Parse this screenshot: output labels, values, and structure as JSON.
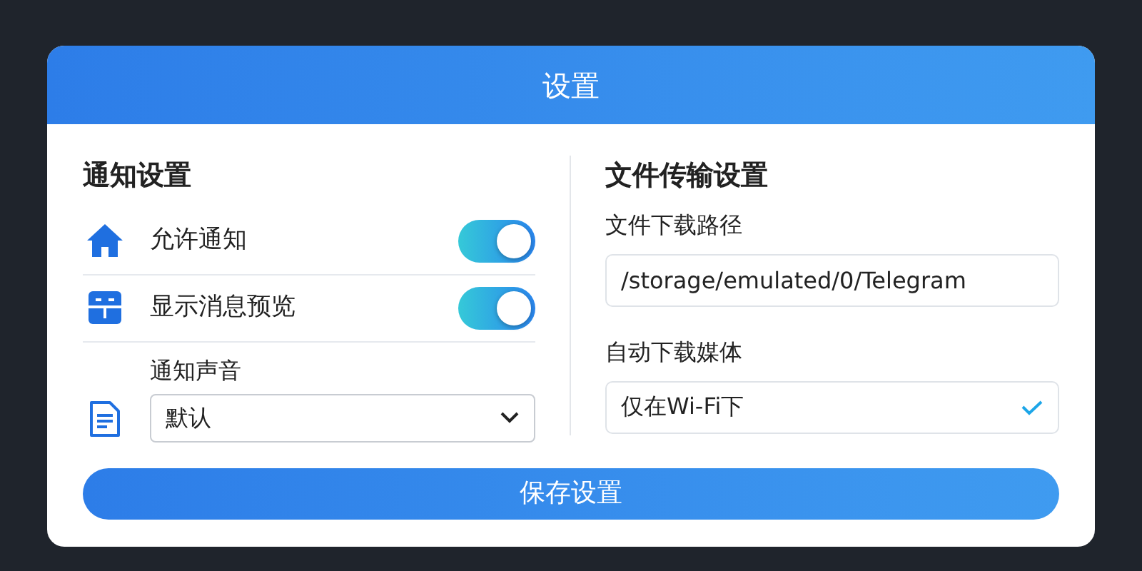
{
  "dialog": {
    "title": "设置"
  },
  "notifications": {
    "heading": "通知设置",
    "toggles": [
      {
        "label": "允许通知",
        "on": true
      },
      {
        "label": "显示消息预览",
        "on": true
      }
    ],
    "sound": {
      "label": "通知声音",
      "value": "默认"
    }
  },
  "file_transfer": {
    "heading": "文件传输设置",
    "path": {
      "label": "文件下载路径",
      "value": "/storage/emulated/0/Telegram"
    },
    "media": {
      "label": "自动下载媒体",
      "value": "仅在Wi-Fi下"
    }
  },
  "save_button": "保存设置"
}
